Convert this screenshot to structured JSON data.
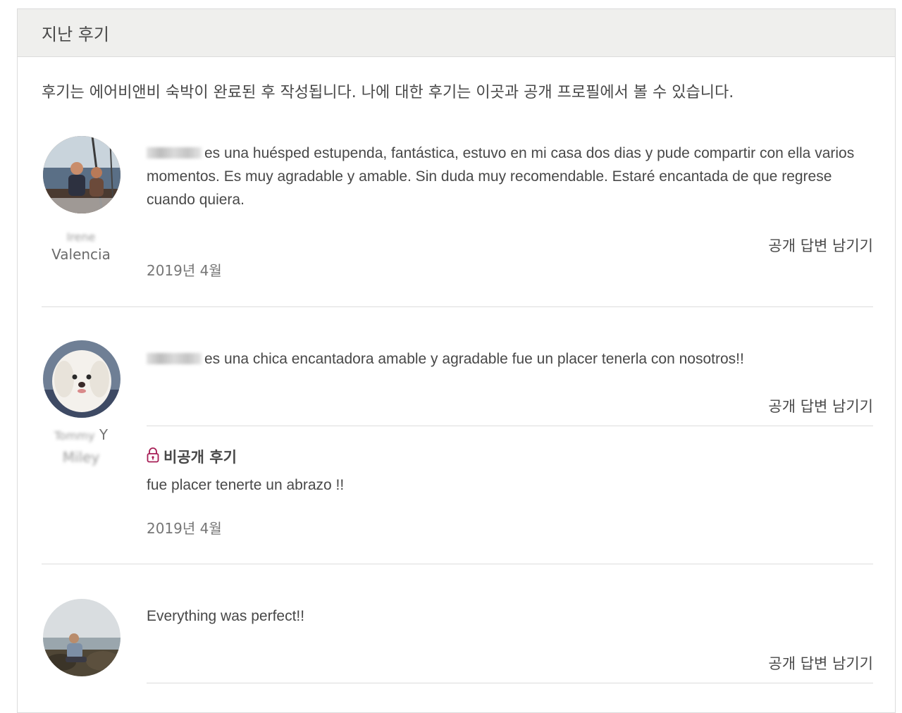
{
  "panel": {
    "title": "지난 후기",
    "intro": "후기는 에어비앤비 숙박이 완료된 후 작성됩니다. 나에 대한 후기는 이곳과 공개 프로필에서 볼 수 있습니다."
  },
  "reviews": [
    {
      "reviewer_name_redacted": "Irene",
      "reviewer_location": "Valencia",
      "text": "es una huésped estupenda, fantástica, estuvo en mi casa dos dias y pude compartir con ella varios momentos. Es muy agradable y amable. Sin duda muy recomendable. Estaré encantada de que regrese cuando quiera.",
      "reply_label": "공개 답변 남기기",
      "date": "2019년 4월"
    },
    {
      "reviewer_name_line1": "Y",
      "reviewer_name_line1_redacted": "Tommy",
      "reviewer_name_line2_redacted": "Miley",
      "text": "es una chica encantadora amable y agradable fue un placer tenerla con nosotros!!",
      "reply_label": "공개 답변 남기기",
      "private_label": "비공개 후기",
      "private_text": "fue placer tenerte un abrazo !!",
      "date": "2019년 4월"
    },
    {
      "text": "Everything was perfect!!",
      "reply_label": "공개 답변 남기기"
    }
  ],
  "colors": {
    "header_bg": "#efefed",
    "lock_icon": "#a61d55",
    "text": "#484848",
    "muted": "#767676"
  }
}
